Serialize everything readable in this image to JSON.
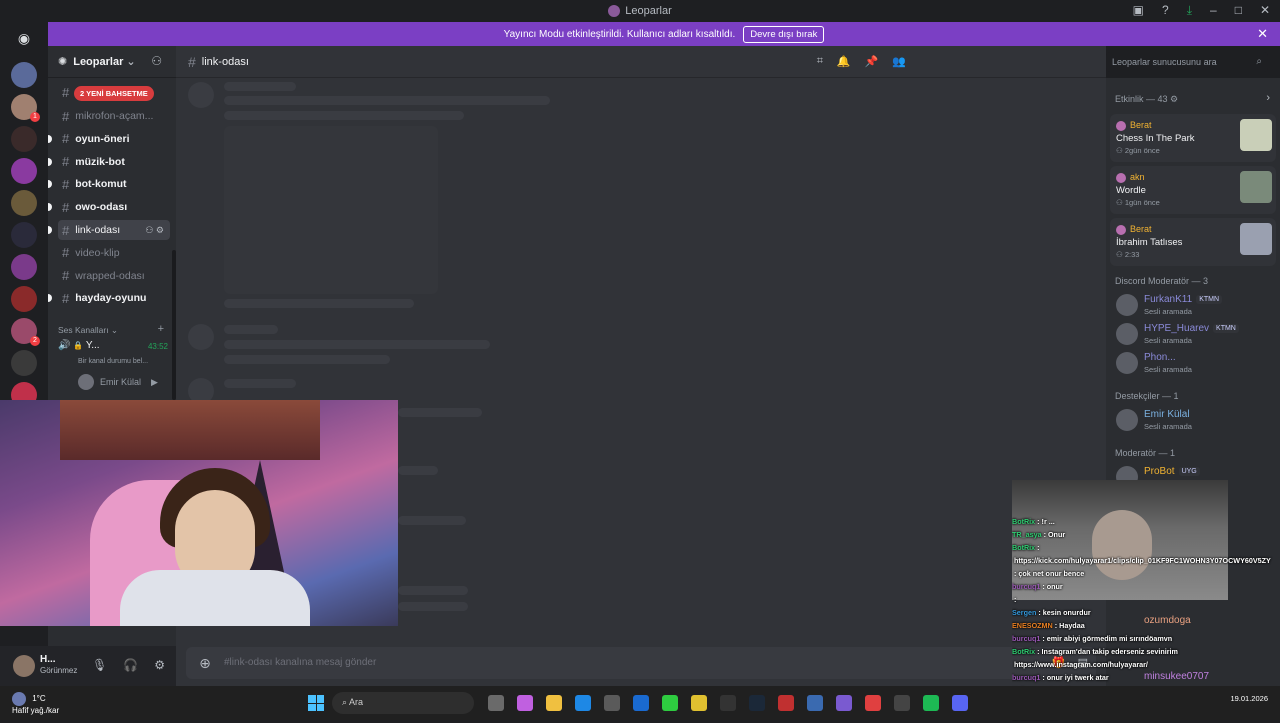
{
  "window": {
    "title": "Leoparlar"
  },
  "banner": {
    "text": "Yayıncı Modu etkinleştirildi. Kullanıcı adları kısaltıldı.",
    "button": "Devre dışı bırak"
  },
  "server": {
    "name": "Leoparlar"
  },
  "mention_pill": "2 YENİ BAHSETME",
  "channels": [
    {
      "name": "mikrofon-açam...",
      "state": "muted"
    },
    {
      "name": "oyun-öneri",
      "state": "unread"
    },
    {
      "name": "müzik-bot",
      "state": "unread"
    },
    {
      "name": "bot-komut",
      "state": "unread"
    },
    {
      "name": "owo-odası",
      "state": "unread"
    },
    {
      "name": "link-odası",
      "state": "selected"
    },
    {
      "name": "video-klip",
      "state": "muted"
    },
    {
      "name": "wrapped-odası",
      "state": "muted"
    },
    {
      "name": "hayday-oyunu",
      "state": "unread"
    }
  ],
  "voice": {
    "section": "Ses Kanalları",
    "channel": "Y...",
    "time": "43:52",
    "status": "Bir kanal durumu bel...",
    "user": "Emir Külal"
  },
  "user_panel": {
    "name": "H...",
    "status": "Görünmez"
  },
  "current_channel": "link-odası",
  "search_placeholder": "Leoparlar sunucusunu ara",
  "composer_placeholder": "#link-odası kanalına mesaj gönder",
  "activity": {
    "header": "Etkinlik — 43",
    "cards": [
      {
        "user": "Berat",
        "title": "Chess In The Park",
        "when": "2gün önce",
        "thumb": "#c9cfb8"
      },
      {
        "user": "akn",
        "title": "Wordle",
        "when": "1gün önce",
        "thumb": "#7a8a7a"
      },
      {
        "user": "Berat",
        "title": "İbrahim Tatlıses",
        "when": "2:33",
        "thumb": "#9aa0b0"
      }
    ]
  },
  "roles": [
    {
      "header": "Discord Moderatör — 3",
      "members": [
        {
          "name": "FurkanK11",
          "tag": "KTMN",
          "sub": "Sesli aramada",
          "color": "#8a8ad8"
        },
        {
          "name": "HYPE_Huarev",
          "tag": "KTMN",
          "sub": "Sesli aramada",
          "color": "#8a8ad8"
        },
        {
          "name": "Phon...",
          "tag": "",
          "sub": "Sesli aramada",
          "color": "#8a8ad8"
        }
      ]
    },
    {
      "header": "Destekçiler — 1",
      "members": [
        {
          "name": "Emir Külal",
          "tag": "",
          "sub": "Sesli aramada",
          "color": "#7ab0e0"
        }
      ]
    },
    {
      "header": "Moderatör — 1",
      "members": [
        {
          "name": "ProBot",
          "tag": "UYG",
          "sub": "",
          "color": "#f0b232"
        }
      ]
    }
  ],
  "overlay_members": [
    "ozumdoga",
    "minsukee0707"
  ],
  "stream_chat": [
    {
      "user": "BotRix",
      "text": ": !r ...",
      "color": "#2ecc71"
    },
    {
      "user": "TR_asya",
      "text": ": Onur",
      "color": "#2ecc71"
    },
    {
      "user": "BotRix",
      "text": ":",
      "color": "#2ecc71"
    },
    {
      "user": "",
      "text": "https://kick.com/hulyayarar1/clips/clip_01KF9FC1WOHN3Y07OCWY60V5ZY",
      "color": "#ffffff"
    },
    {
      "user": "",
      "text": ": çok net onur bence",
      "color": "#e74c3c"
    },
    {
      "user": "burcuq1",
      "text": ": onur",
      "color": "#9b59b6"
    },
    {
      "user": "",
      "text": ":",
      "color": "#e74c3c"
    },
    {
      "user": "Sergen",
      "text": ": kesin onurdur",
      "color": "#3498db"
    },
    {
      "user": "ENESOZMN",
      "text": ": Haydaa",
      "color": "#e67e22"
    },
    {
      "user": "burcuq1",
      "text": ": emir abiyi görmedim mi sırındöamvn",
      "color": "#9b59b6"
    },
    {
      "user": "BotRix",
      "text": ": Instagram'dan takip ederseniz sevinirim",
      "color": "#2ecc71"
    },
    {
      "user": "",
      "text": "https://www.instagram.com/hulyayarar/",
      "color": "#ffffff"
    },
    {
      "user": "burcuq1",
      "text": ": onur iyi twerk atar",
      "color": "#9b59b6"
    },
    {
      "user": "Hulyayarar1",
      "text": ": !clip",
      "color": "#f1c40f"
    },
    {
      "user": "BotRix",
      "text": ": @Hulyayarar1 Bu komutu 12s içerisinde tekrar kullanabilirsiniz.",
      "color": "#2ecc71"
    },
    {
      "user": "ENESOZMN",
      "text": ":",
      "color": "#e67e22"
    }
  ],
  "taskbar": {
    "temp": "1°C",
    "weather": "Hafif yağ./kar",
    "search": "Ara",
    "date": "19.01.2026"
  }
}
